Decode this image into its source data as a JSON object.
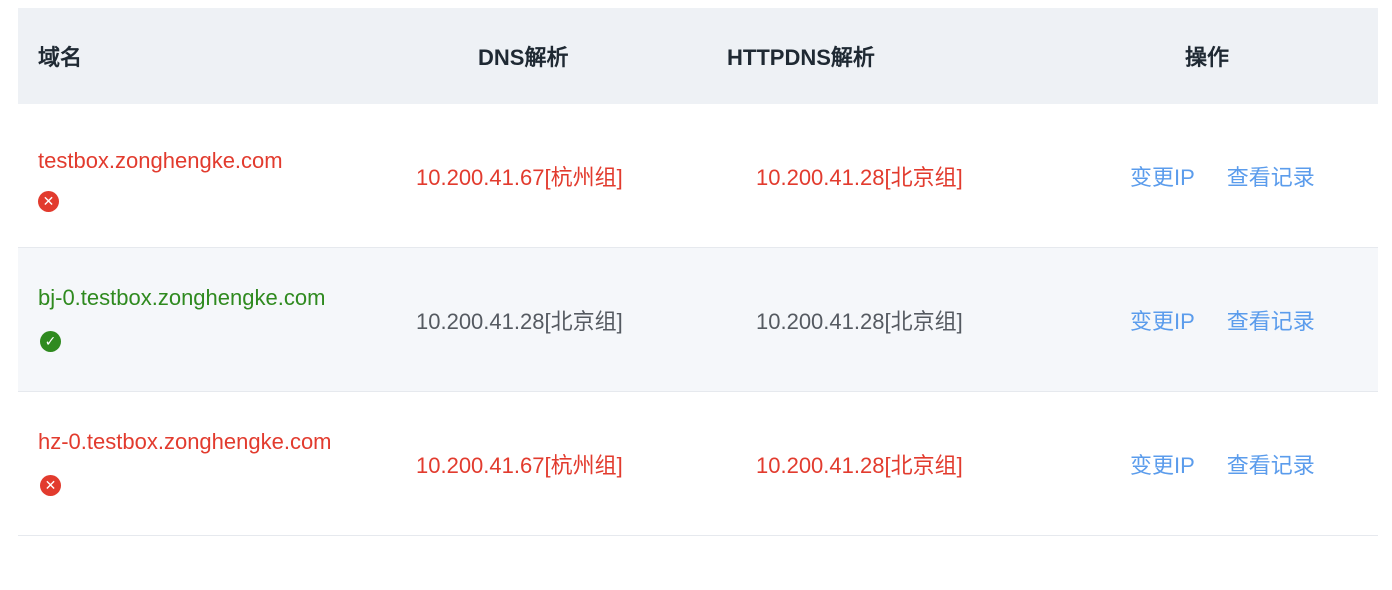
{
  "header": {
    "domain": "域名",
    "dns": "DNS解析",
    "httpdns": "HTTPDNS解析",
    "ops": "操作"
  },
  "colors": {
    "error": "#e23b2e",
    "ok": "#2f8a1f",
    "link": "#5b9cec",
    "header_bg": "#eef1f5"
  },
  "rows": [
    {
      "domain": "testbox.zonghengke.com",
      "status": "error-icon",
      "dns": "10.200.41.67[杭州组]",
      "httpdns": "10.200.41.28[北京组]",
      "change_ip": "变更IP",
      "view_log": "查看记录"
    },
    {
      "domain": "bj-0.testbox.zonghengke.com",
      "status": "check-icon",
      "dns": "10.200.41.28[北京组]",
      "httpdns": "10.200.41.28[北京组]",
      "change_ip": "变更IP",
      "view_log": "查看记录"
    },
    {
      "domain": "hz-0.testbox.zonghengke.com",
      "status": "error-icon",
      "dns": "10.200.41.67[杭州组]",
      "httpdns": "10.200.41.28[北京组]",
      "change_ip": "变更IP",
      "view_log": "查看记录"
    }
  ]
}
